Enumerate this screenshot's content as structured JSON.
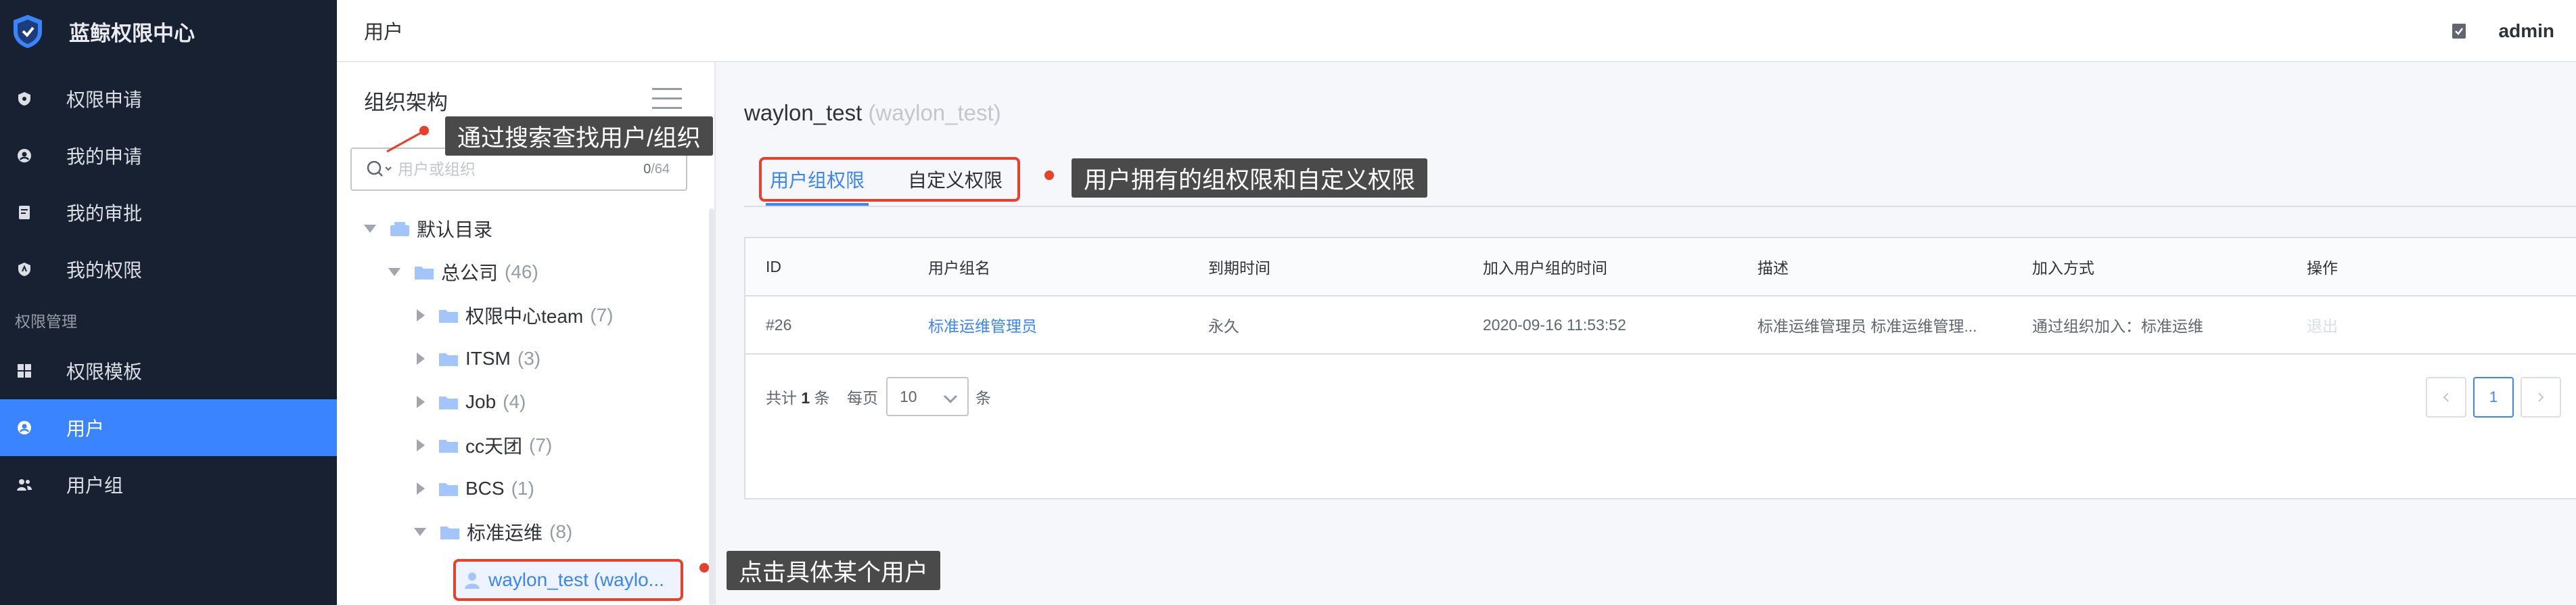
{
  "app": {
    "title": "蓝鲸权限中心"
  },
  "sidebar": {
    "items": [
      {
        "label": "权限申请",
        "icon": "permission-apply-icon"
      },
      {
        "label": "我的申请",
        "icon": "my-apply-icon"
      },
      {
        "label": "我的审批",
        "icon": "my-approval-icon"
      },
      {
        "label": "我的权限",
        "icon": "my-permission-icon"
      }
    ],
    "section_label": "权限管理",
    "admin_items": [
      {
        "label": "权限模板",
        "icon": "template-icon"
      },
      {
        "label": "用户",
        "icon": "user-icon",
        "active": true
      },
      {
        "label": "用户组",
        "icon": "user-group-icon"
      }
    ]
  },
  "header": {
    "title": "用户",
    "username": "admin"
  },
  "org": {
    "title": "组织架构",
    "search_placeholder": "用户或组织",
    "search_count": "0",
    "search_max": "/64",
    "tree": [
      {
        "label": "默认目录",
        "count": ""
      },
      {
        "label": "总公司",
        "count": "(46)"
      },
      {
        "label": "权限中心team",
        "count": "(7)"
      },
      {
        "label": "ITSM",
        "count": "(3)"
      },
      {
        "label": "Job",
        "count": "(4)"
      },
      {
        "label": "cc天团",
        "count": "(7)"
      },
      {
        "label": "BCS",
        "count": "(1)"
      },
      {
        "label": "标准运维",
        "count": "(8)"
      }
    ],
    "selected_user": "waylon_test (waylo..."
  },
  "main": {
    "user_name": "waylon_test",
    "user_sub": "(waylon_test)",
    "tabs": [
      "用户组权限",
      "自定义权限"
    ],
    "table": {
      "headers": [
        "ID",
        "用户组名",
        "到期时间",
        "加入用户组的时间",
        "描述",
        "加入方式",
        "操作"
      ],
      "rows": [
        [
          "#26",
          "标准运维管理员",
          "永久",
          "2020-09-16 11:53:52",
          "标准运维管理员 标准运维管理...",
          "通过组织加入：标准运维",
          "退出"
        ]
      ]
    },
    "pagination": {
      "total_prefix": "共计",
      "total": "1",
      "total_suffix": "条",
      "per_page_label": "每页",
      "per_page": "10",
      "per_page_unit": "条",
      "current_page": "1"
    }
  },
  "annotations": {
    "search_tip": "通过搜索查找用户/组织",
    "tabs_tip": "用户拥有的组权限和自定义权限",
    "user_tip": "点击具体某个用户"
  },
  "colors": {
    "sidebar_bg": "#182132",
    "accent": "#3a84ff",
    "highlight": "#e8412b",
    "callout_bg": "#4a4a4a"
  }
}
